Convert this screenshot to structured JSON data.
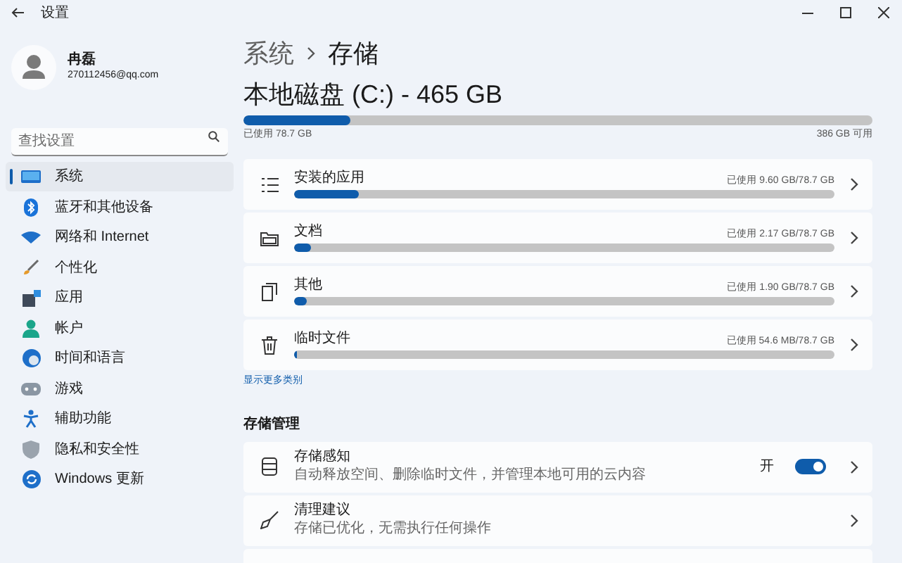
{
  "window": {
    "title": "设置"
  },
  "user": {
    "name": "冉磊",
    "email": "270112456@qq.com"
  },
  "search": {
    "placeholder": "查找设置"
  },
  "nav": [
    {
      "label": "系统",
      "selected": true
    },
    {
      "label": "蓝牙和其他设备",
      "selected": false
    },
    {
      "label": "网络和 Internet",
      "selected": false
    },
    {
      "label": "个性化",
      "selected": false
    },
    {
      "label": "应用",
      "selected": false
    },
    {
      "label": "帐户",
      "selected": false
    },
    {
      "label": "时间和语言",
      "selected": false
    },
    {
      "label": "游戏",
      "selected": false
    },
    {
      "label": "辅助功能",
      "selected": false
    },
    {
      "label": "隐私和安全性",
      "selected": false
    },
    {
      "label": "Windows 更新",
      "selected": false
    }
  ],
  "breadcrumb": [
    "系统",
    "存储"
  ],
  "disk": {
    "title": "本地磁盘 (C:) - 465 GB",
    "level": 0.17,
    "used": "已使用 78.7 GB",
    "free": "386 GB 可用"
  },
  "categories": [
    {
      "label": "安装的应用",
      "usage": "已使用 9.60 GB/78.7 GB",
      "level": 0.12
    },
    {
      "label": "文档",
      "usage": "已使用 2.17 GB/78.7 GB",
      "level": 0.03
    },
    {
      "label": "其他",
      "usage": "已使用 1.90 GB/78.7 GB",
      "level": 0.024
    },
    {
      "label": "临时文件",
      "usage": "已使用 54.6 MB/78.7 GB",
      "level": 0.005
    }
  ],
  "show_more": "显示更多类别",
  "management": {
    "heading": "存储管理",
    "items": [
      {
        "kind": "toggle",
        "title": "存储感知",
        "subtitle": "自动释放空间、删除临时文件，并管理本地可用的云内容",
        "state_label": "开",
        "on": true
      },
      {
        "kind": "link",
        "title": "清理建议",
        "subtitle": "存储已优化，无需执行任何操作"
      },
      {
        "kind": "empty"
      }
    ]
  }
}
